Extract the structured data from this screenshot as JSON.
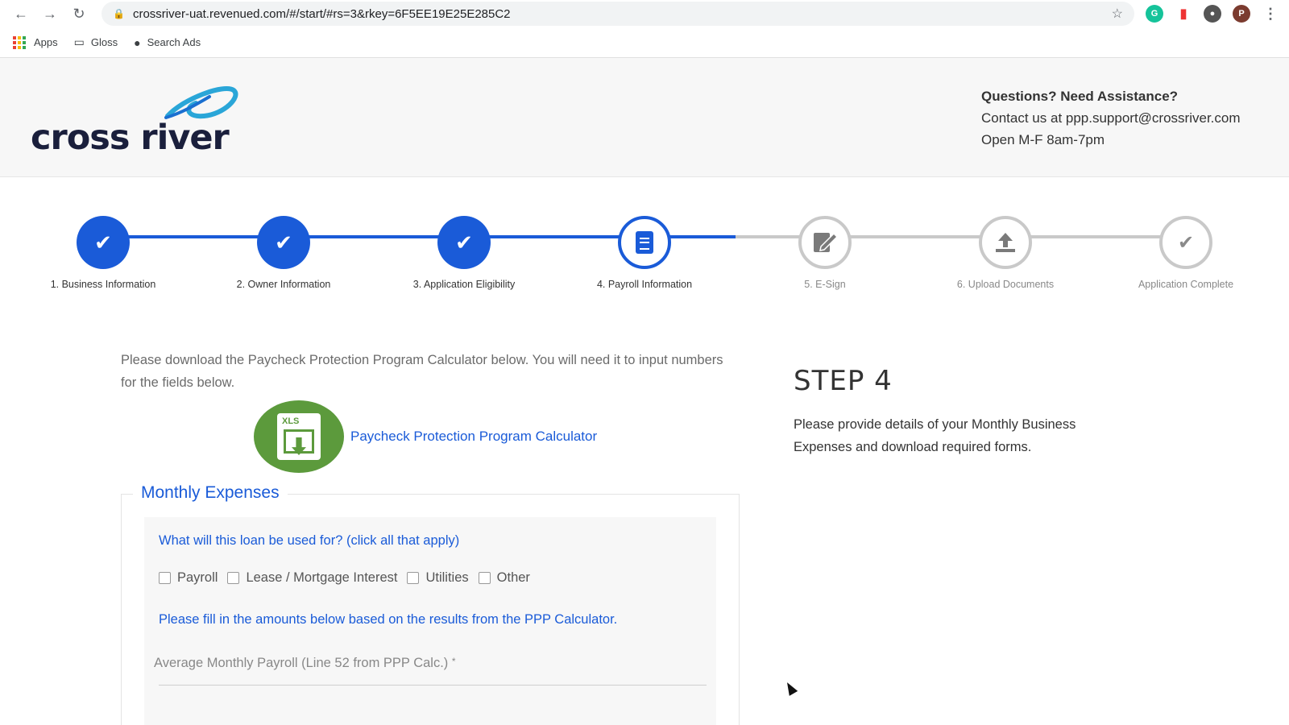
{
  "browser": {
    "url": "crossriver-uat.revenued.com/#/start/#rs=3&rkey=6F5EE19E25E285C2",
    "profile_initial": "P",
    "bookmarks": [
      {
        "label": "Apps",
        "icon": "apps-grid-icon"
      },
      {
        "label": "Gloss",
        "icon": "folder-icon"
      },
      {
        "label": "Search Ads",
        "icon": "apple-icon"
      }
    ]
  },
  "header": {
    "logo_text": "cross river",
    "contact_title": "Questions? Need Assistance?",
    "contact_line": "Contact us at ppp.support@crossriver.com",
    "hours": "Open M-F 8am-7pm"
  },
  "stepper": {
    "steps": [
      {
        "label": "1. Business Information",
        "state": "done",
        "icon": "check-icon"
      },
      {
        "label": "2. Owner Information",
        "state": "done",
        "icon": "check-icon"
      },
      {
        "label": "3. Application Eligibility",
        "state": "done",
        "icon": "check-icon"
      },
      {
        "label": "4. Payroll Information",
        "state": "current",
        "icon": "document-icon"
      },
      {
        "label": "5. E-Sign",
        "state": "todo",
        "icon": "esign-icon"
      },
      {
        "label": "6. Upload Documents",
        "state": "todo",
        "icon": "upload-icon"
      },
      {
        "label": "Application Complete",
        "state": "todo",
        "icon": "check-icon"
      }
    ],
    "colors": {
      "active": "#1a5bd8",
      "inactive": "#c9c9c9"
    }
  },
  "main": {
    "intro": "Please download the Paycheck Protection Program Calculator below. You will need it to input numbers for the fields below.",
    "calculator_icon_label": "XLS",
    "calculator_link": "Paycheck Protection Program Calculator",
    "step_title": "STEP 4",
    "step_description": "Please provide details of your Monthly Business Expenses and download required forms.",
    "expenses": {
      "legend": "Monthly Expenses",
      "question": "What will this loan be used for? (click all that apply)",
      "options": [
        "Payroll",
        "Lease / Mortgage Interest",
        "Utilities",
        "Other"
      ],
      "fill_note": "Please fill in the amounts below based on the results from the PPP Calculator.",
      "payroll_label": "Average Monthly Payroll (Line 52 from PPP Calc.)",
      "required_mark": "*"
    }
  }
}
